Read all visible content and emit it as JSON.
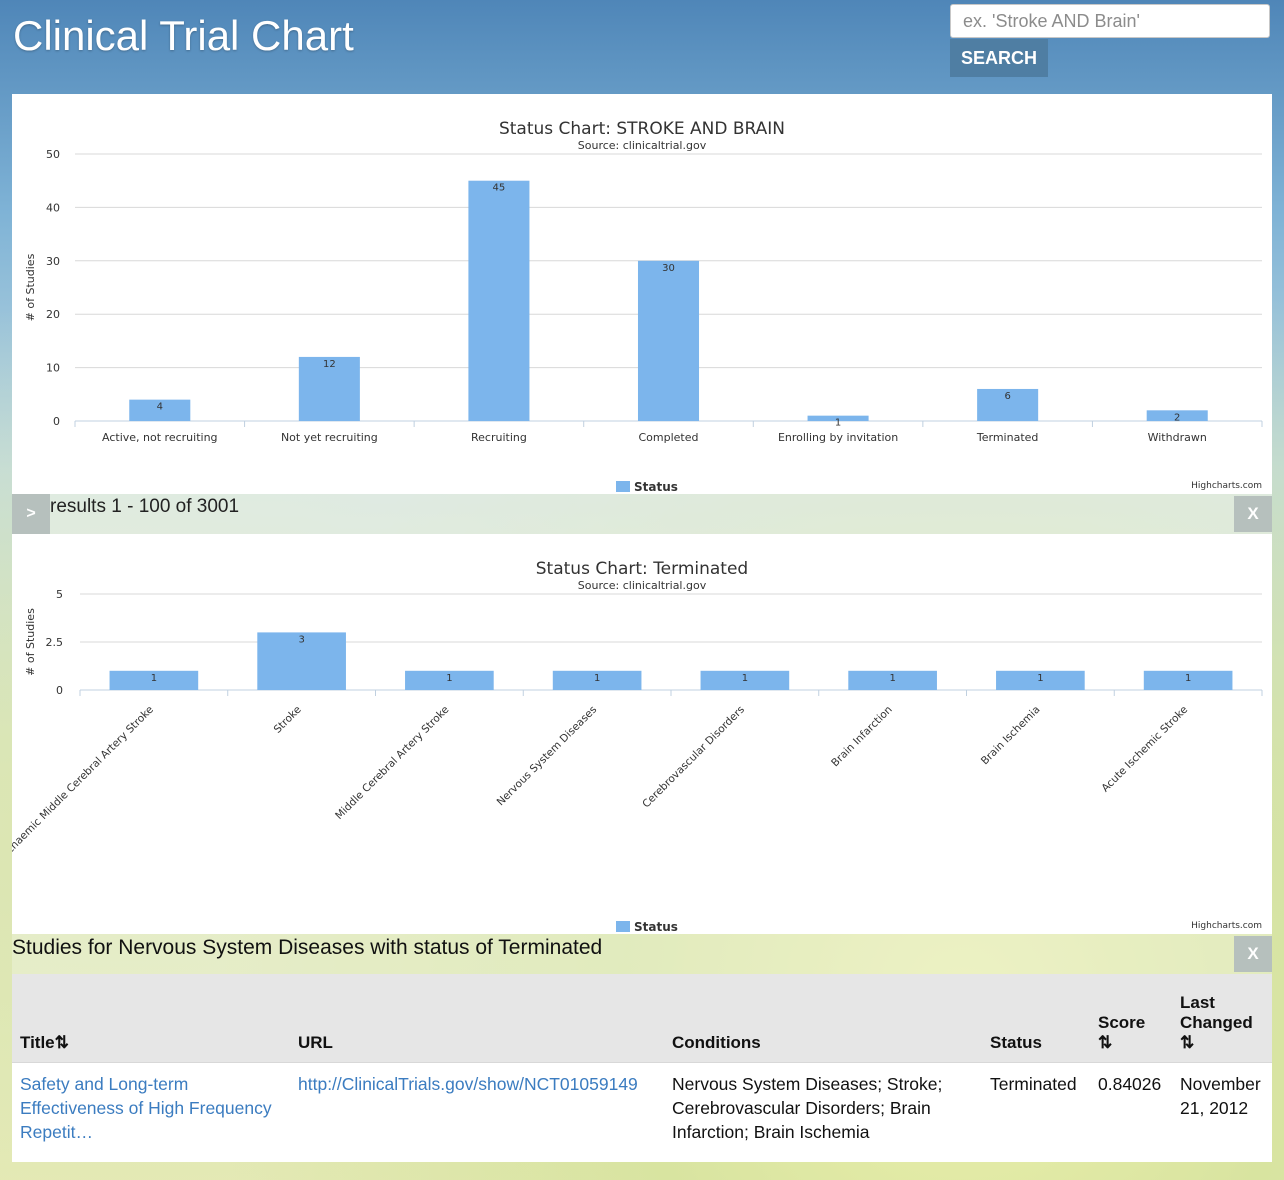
{
  "header": {
    "title": "Clinical Trial Chart",
    "search_placeholder": "ex. 'Stroke AND Brain'",
    "search_value": "",
    "search_button": "SEARCH"
  },
  "results_bar": {
    "expand_label": ">",
    "text": "results 1 - 100 of 3001",
    "close_label": "X"
  },
  "studies": {
    "heading": "Studies for Nervous System Diseases with status of Terminated",
    "close_label": "X",
    "columns": {
      "title": "Title",
      "url": "URL",
      "conditions": "Conditions",
      "status": "Status",
      "score": "Score",
      "last_changed_line1": "Last",
      "last_changed_line2": "Changed"
    },
    "sort_icon": "⇅",
    "rows": [
      {
        "title": "Safety and Long-term Effectiveness of High Frequency Repetit…",
        "url": "http://ClinicalTrials.gov/show/NCT01059149",
        "conditions": "Nervous System Diseases; Stroke; Cerebrovascular Disorders; Brain Infarction; Brain Ischemia",
        "status": "Terminated",
        "score": "0.84026",
        "last_changed": "November 21, 2012"
      }
    ]
  },
  "colors": {
    "bar": "#7cb5ec",
    "link": "#3b7cc0",
    "search_button": "#4f7ea3"
  },
  "chart_data": [
    {
      "type": "bar",
      "title": "Status Chart: STROKE AND BRAIN",
      "subtitle": "Source: clinicaltrial.gov",
      "ylabel": "# of Studies",
      "xlabel": "",
      "ylim": [
        0,
        50
      ],
      "yticks": [
        "0",
        "10",
        "20",
        "30",
        "40",
        "50"
      ],
      "categories": [
        "Active, not recruiting",
        "Not yet recruiting",
        "Recruiting",
        "Completed",
        "Enrolling by invitation",
        "Terminated",
        "Withdrawn"
      ],
      "series": [
        {
          "name": "Status",
          "values": [
            4,
            12,
            45,
            30,
            1,
            6,
            2
          ]
        }
      ],
      "legend": "bottom-center",
      "credits": "Highcharts.com",
      "grid": true
    },
    {
      "type": "bar",
      "title": "Status Chart: Terminated",
      "subtitle": "Source: clinicaltrial.gov",
      "ylabel": "# of Studies",
      "xlabel": "",
      "ylim": [
        0,
        5
      ],
      "yticks": [
        "0",
        "2.5",
        "5"
      ],
      "categories": [
        "Ischaemic Middle Cerebral Artery Stroke",
        "Stroke",
        "Middle Cerebral Artery Stroke",
        "Nervous System Diseases",
        "Cerebrovascular Disorders",
        "Brain Infarction",
        "Brain Ischemia",
        "Acute Ischemic Stroke"
      ],
      "series": [
        {
          "name": "Status",
          "values": [
            1,
            3,
            1,
            1,
            1,
            1,
            1,
            1
          ]
        }
      ],
      "legend": "bottom-center",
      "credits": "Highcharts.com",
      "grid": true
    }
  ]
}
